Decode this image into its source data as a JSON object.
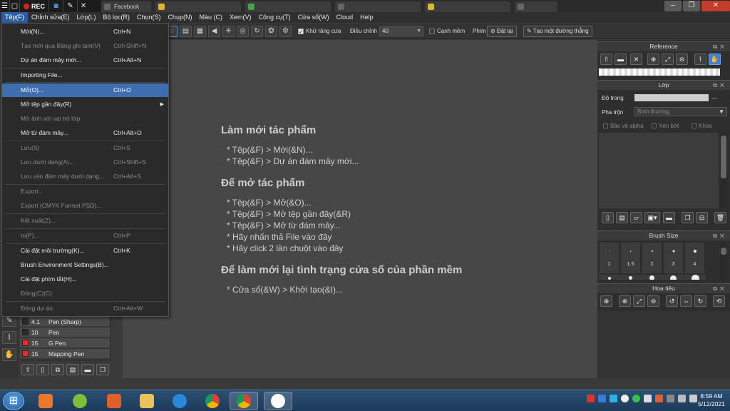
{
  "recorder": {
    "rec_label": "REC"
  },
  "browser_tabs": [
    "Facebook",
    "",
    "",
    "",
    "",
    "",
    ""
  ],
  "menubar": [
    "Tệp(F)",
    "Chỉnh sửa(E)",
    "Lớp(L)",
    "Bộ lọc(R)",
    "Chọn(S)",
    "Chụp(N)",
    "Màu (C)",
    "Xem(V)",
    "Công cụ(T)",
    "Cửa sổ(W)",
    "Cloud",
    "Help"
  ],
  "toolbar": {
    "antialias_label": "Khử răng cưa",
    "adjust_label": "Điều chỉnh",
    "adjust_value": "40",
    "edge_label": "Cạnh mềm",
    "key_label": "Phím",
    "reset_label": "Đặt lại",
    "line_label": "Tạo một đường thẳng"
  },
  "file_menu": [
    {
      "label": "Mới(N)...",
      "shortcut": "Ctrl+N",
      "state": "normal"
    },
    {
      "label": "Tạo mới qua Bảng ghi tạm(V)",
      "shortcut": "Ctrl+Shift+N",
      "state": "disabled"
    },
    {
      "label": "Dự án đám mây mới...",
      "shortcut": "Ctrl+Alt+N",
      "state": "normal"
    },
    {
      "label": "Importing File...",
      "shortcut": "",
      "state": "normal"
    },
    {
      "label": "Mở(O)...",
      "shortcut": "Ctrl+O",
      "state": "selected"
    },
    {
      "label": "Mở tệp gần đây(R)",
      "shortcut": "",
      "state": "normal",
      "submenu": true
    },
    {
      "label": "Mở ảnh với vai trò lớp",
      "shortcut": "",
      "state": "disabled"
    },
    {
      "label": "Mở từ đám mây...",
      "shortcut": "Ctrl+Alt+O",
      "state": "normal"
    },
    {
      "label": "Lưu(S)",
      "shortcut": "Ctrl+S",
      "state": "disabled"
    },
    {
      "label": "Lưu dưới dạng(A)...",
      "shortcut": "Ctrl+Shift+S",
      "state": "disabled"
    },
    {
      "label": "Lưu vào đám mây dưới dạng...",
      "shortcut": "Ctrl+Alt+S",
      "state": "disabled"
    },
    {
      "label": "Export...",
      "shortcut": "",
      "state": "disabled"
    },
    {
      "label": "Export (CMYK Format PSD)...",
      "shortcut": "",
      "state": "disabled"
    },
    {
      "label": "Kết xuất(Z)...",
      "shortcut": "",
      "state": "disabled"
    },
    {
      "label": "In(P)...",
      "shortcut": "Ctrl+P",
      "state": "disabled"
    },
    {
      "label": "Cài đặt môi trường(K)...",
      "shortcut": "Ctrl+K",
      "state": "normal"
    },
    {
      "label": "Brush Environment Settings(B)...",
      "shortcut": "",
      "state": "normal"
    },
    {
      "label": "Cài đặt phím tắt(H)...",
      "shortcut": "",
      "state": "normal"
    },
    {
      "label": "Đóng(C)(C)",
      "shortcut": "",
      "state": "disabled"
    },
    {
      "label": "Đóng dự án",
      "shortcut": "Ctrl+Alt+W",
      "state": "disabled"
    }
  ],
  "welcome": {
    "new_heading": "Làm mới tác phẩm",
    "new_lines": [
      "* Tệp(&F) > Mới(&N)...",
      "* Tệp(&F) > Dự án đám mây mới..."
    ],
    "open_heading": "Để mở tác phẩm",
    "open_lines": [
      "* Tệp(&F) > Mở(&O)...",
      "* Tệp(&F) > Mở tệp gần đây(&R)",
      "* Tệp(&F) > Mở từ đám mây...",
      "* Hãy nhấn thả File vào đây",
      "* Hãy click 2 lần chuột vào đây"
    ],
    "reset_heading": "Để làm mới lại tình trạng cửa sổ của phần mềm",
    "reset_lines": [
      "* Cửa sổ(&W) > Khởi tạo(&I)..."
    ]
  },
  "brushes": [
    {
      "size": "4.1",
      "name": "Pen (Sharp)",
      "color": "#2a2a2a"
    },
    {
      "size": "10",
      "name": "Pen",
      "color": "#2a2a2a"
    },
    {
      "size": "15",
      "name": "G Pen",
      "color": "#e03030"
    },
    {
      "size": "15",
      "name": "Mapping Pen",
      "color": "#e03030"
    }
  ],
  "reference_panel": {
    "title": "Reference"
  },
  "layer_panel": {
    "title": "Lớp",
    "opacity_label": "Độ trong",
    "opacity_value": "---",
    "blend_label": "Pha trộn",
    "blend_value": "Bình thường",
    "protect_alpha": "Bảo vệ alpha",
    "clip": "Xén bớt",
    "lock": "Khóa"
  },
  "brush_size_panel": {
    "title": "Brush Size",
    "sizes": [
      "1",
      "1.5",
      "2",
      "3",
      "4"
    ]
  },
  "navigator_panel": {
    "title": "Hoa tiêu"
  },
  "clock": {
    "time": "8:59 AM",
    "date": "5/12/2021"
  }
}
